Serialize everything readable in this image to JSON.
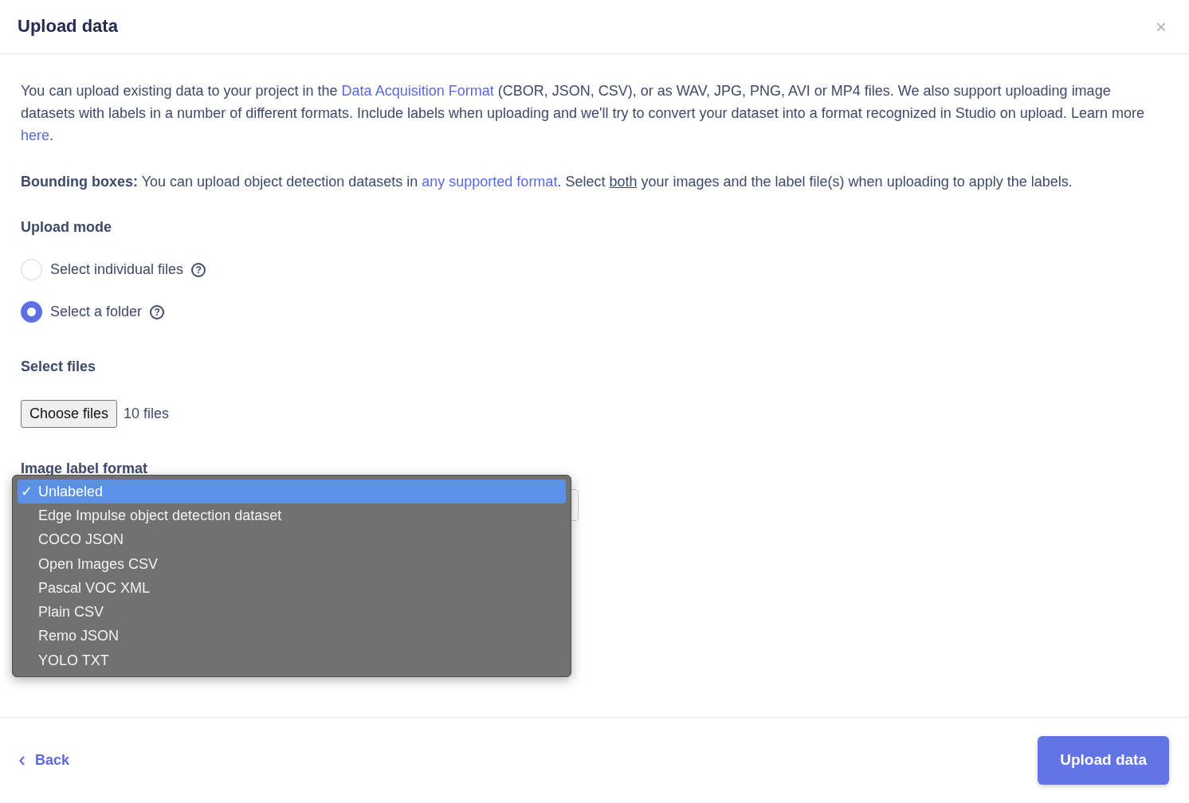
{
  "dialog": {
    "title": "Upload data",
    "close": "×"
  },
  "intro": [
    {
      "kind": "text",
      "text": "You can upload existing data to your project in the "
    },
    {
      "kind": "link",
      "text": "Data Acquisition Format"
    },
    {
      "kind": "text",
      "text": " (CBOR, JSON, CSV), or as WAV, JPG, PNG, AVI or MP4 files. We also support uploading image datasets with labels in a number of different formats. Include labels when uploading and we'll try to convert your dataset into a format recognized in Studio on upload. Learn more "
    },
    {
      "kind": "link",
      "text": "here"
    },
    {
      "kind": "text",
      "text": "."
    }
  ],
  "bounding_note": [
    {
      "kind": "bold",
      "text": "Bounding boxes:"
    },
    {
      "kind": "text",
      "text": " You can upload object detection datasets in "
    },
    {
      "kind": "link",
      "text": "any supported format"
    },
    {
      "kind": "text",
      "text": ". Select "
    },
    {
      "kind": "underline",
      "text": "both"
    },
    {
      "kind": "text",
      "text": " your images and the label file(s) when uploading to apply the labels."
    }
  ],
  "upload_mode": {
    "label": "Upload mode",
    "options": [
      {
        "label": "Select individual files",
        "help": "?",
        "selected": false
      },
      {
        "label": "Select a folder",
        "help": "?",
        "selected": true
      }
    ]
  },
  "select_files": {
    "label": "Select files",
    "button": "Choose files",
    "status": "10 files"
  },
  "label_format": {
    "label": "Image label format",
    "check_mark": "✓",
    "options": [
      {
        "label": "Unlabeled",
        "selected": true
      },
      {
        "label": "Edge Impulse object detection dataset",
        "selected": false
      },
      {
        "label": "COCO JSON",
        "selected": false
      },
      {
        "label": "Open Images CSV",
        "selected": false
      },
      {
        "label": "Pascal VOC XML",
        "selected": false
      },
      {
        "label": "Plain CSV",
        "selected": false
      },
      {
        "label": "Remo JSON",
        "selected": false
      },
      {
        "label": "YOLO TXT",
        "selected": false
      }
    ]
  },
  "footer": {
    "back": "Back",
    "submit": "Upload data"
  }
}
